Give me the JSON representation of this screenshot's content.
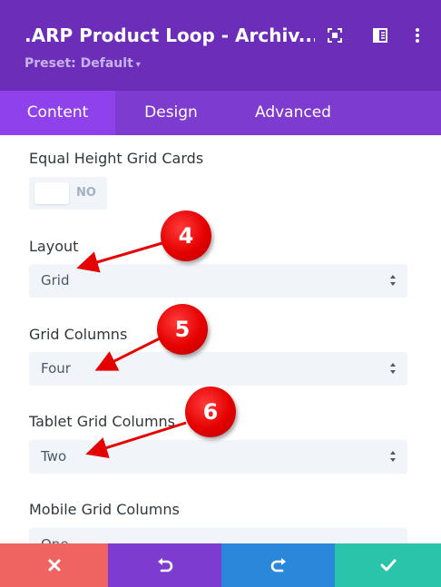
{
  "header": {
    "title": ".ARP Product Loop - Archiv...",
    "preset_label": "Preset: Default",
    "background": "#6c2eb9"
  },
  "header_icons": [
    "expand-icon",
    "sidebar-layout-icon",
    "more-vertical-icon"
  ],
  "tabs": [
    {
      "label": "Content",
      "active": true
    },
    {
      "label": "Design",
      "active": false
    },
    {
      "label": "Advanced",
      "active": false
    }
  ],
  "fields": {
    "equal_height": {
      "label": "Equal Height Grid Cards",
      "value": "NO"
    },
    "layout": {
      "label": "Layout",
      "value": "Grid"
    },
    "grid_columns": {
      "label": "Grid Columns",
      "value": "Four"
    },
    "tablet_grid_columns": {
      "label": "Tablet Grid Columns",
      "value": "Two"
    },
    "mobile_grid_columns": {
      "label": "Mobile Grid Columns",
      "value": "One"
    }
  },
  "annotations": [
    "4",
    "5",
    "6"
  ],
  "footer": {
    "buttons": [
      {
        "icon": "close-icon",
        "color": "#ef6461"
      },
      {
        "icon": "undo-icon",
        "color": "#7e3bd0"
      },
      {
        "icon": "redo-icon",
        "color": "#2b87da"
      },
      {
        "icon": "check-icon",
        "color": "#29c4a9"
      }
    ]
  }
}
